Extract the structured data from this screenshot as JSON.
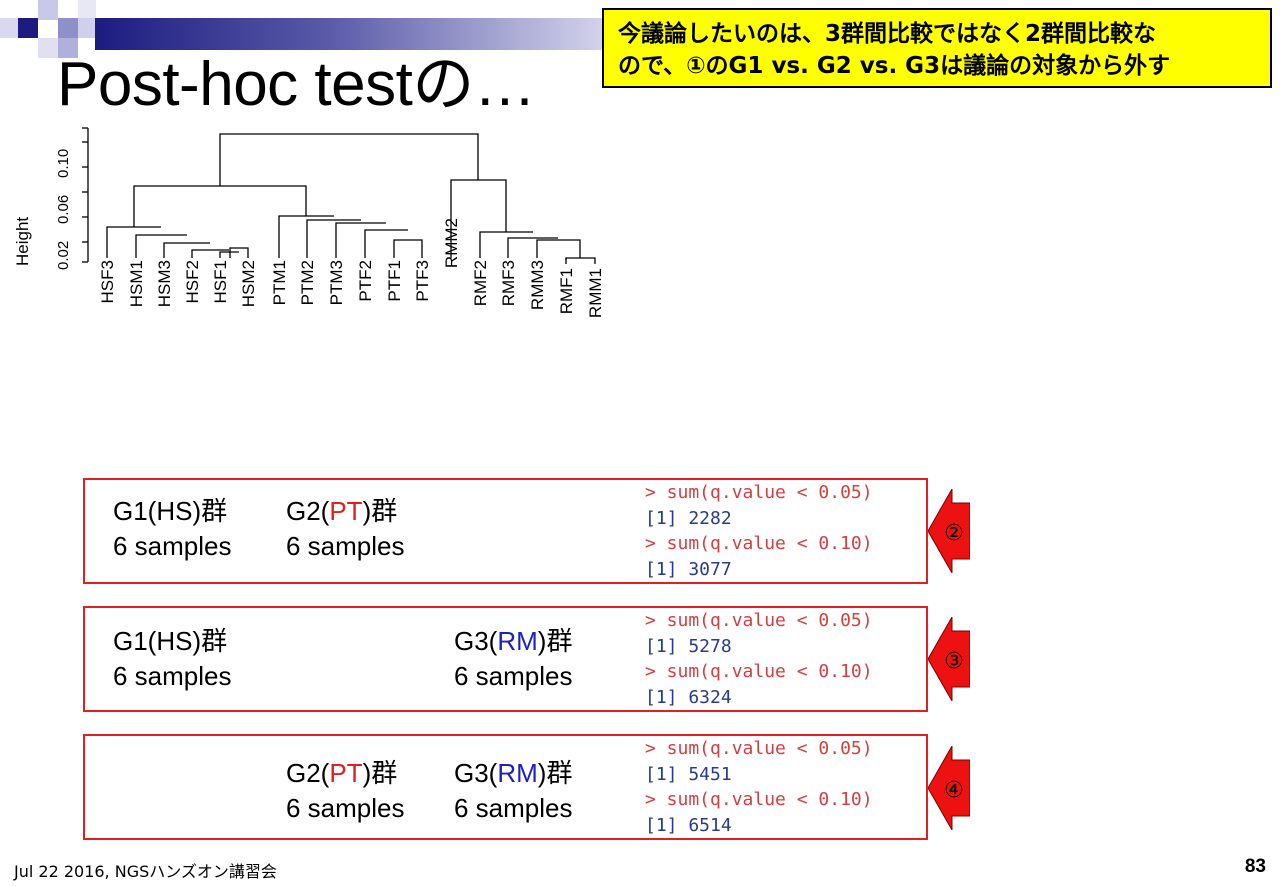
{
  "slide": {
    "title": "Post-hoc testの…",
    "note_lines": [
      "今議論したいのは、3群間比較ではなく2群間比較な",
      "ので、①のG1 vs. G2 vs. G3は議論の対象から外す"
    ],
    "footer_left": "Jul 22 2016, NGSハンズオン講習会",
    "page_number": "83",
    "colors": {
      "title_bar": "#1c1c80",
      "note_bg": "#ffff00",
      "box_border": "#e02020",
      "pt": "#e02020",
      "rm": "#2020c0"
    }
  },
  "dendrogram": {
    "ylabel": "Height",
    "yticks": [
      "0.02",
      "0.06",
      "0.10"
    ],
    "leaves": [
      "HSF3",
      "HSM1",
      "HSM3",
      "HSF2",
      "HSF1",
      "HSM2",
      "PTM1",
      "PTM2",
      "PTM3",
      "PTF2",
      "PTF1",
      "PTF3",
      "RMM2",
      "RMF2",
      "RMF3",
      "RMM3",
      "RMF1",
      "RMM1"
    ]
  },
  "comparisons": [
    {
      "id": "2",
      "g1": {
        "name": "G1(HS)群",
        "pre": "G1(",
        "code": "HS",
        "post": ")群",
        "samples": "6 samples"
      },
      "g2": {
        "pre": "G2(",
        "code": "PT",
        "post": ")群",
        "samples": "6 samples"
      },
      "badge": "②",
      "r_output": [
        "> sum(q.value < 0.05)",
        "[1] 2282",
        "> sum(q.value < 0.10)",
        "[1] 3077"
      ]
    },
    {
      "id": "3",
      "g1": {
        "pre": "G1(",
        "code": "HS",
        "post": ")群",
        "samples": "6 samples"
      },
      "g3": {
        "pre": "G3(",
        "code": "RM",
        "post": ")群",
        "samples": "6 samples"
      },
      "badge": "③",
      "r_output": [
        "> sum(q.value < 0.05)",
        "[1] 5278",
        "> sum(q.value < 0.10)",
        "[1] 6324"
      ]
    },
    {
      "id": "4",
      "g2": {
        "pre": "G2(",
        "code": "PT",
        "post": ")群",
        "samples": "6 samples"
      },
      "g3": {
        "pre": "G3(",
        "code": "RM",
        "post": ")群",
        "samples": "6 samples"
      },
      "badge": "④",
      "r_output": [
        "> sum(q.value < 0.05)",
        "[1] 5451",
        "> sum(q.value < 0.10)",
        "[1] 6514"
      ]
    }
  ]
}
